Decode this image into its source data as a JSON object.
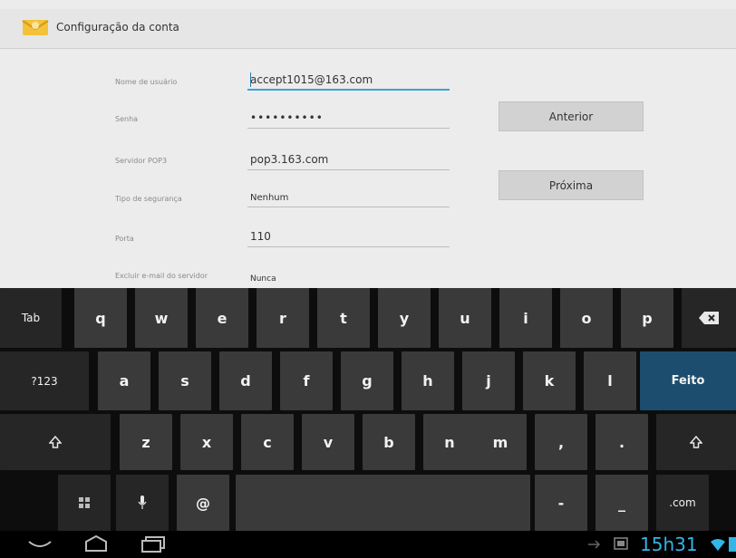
{
  "header": {
    "title": "Configuração da conta"
  },
  "form": {
    "fields": [
      {
        "label": "Nome de usuário",
        "value": "accept1015@163.com"
      },
      {
        "label": "Senha",
        "value": "••••••••••"
      },
      {
        "label": "Servidor POP3",
        "value": "pop3.163.com"
      },
      {
        "label": "Tipo de segurança",
        "value": "Nenhum"
      },
      {
        "label": "Porta",
        "value": "110"
      },
      {
        "label": "Excluir e-mail do servidor",
        "value": "Nunca"
      }
    ]
  },
  "buttons": {
    "previous": "Anterior",
    "next": "Próxima"
  },
  "keyboard": {
    "row1": [
      "Tab",
      "q",
      "w",
      "e",
      "r",
      "t",
      "y",
      "u",
      "i",
      "o",
      "p"
    ],
    "row2": [
      "?123",
      "a",
      "s",
      "d",
      "f",
      "g",
      "h",
      "j",
      "k",
      "l",
      "Feito"
    ],
    "row3": [
      "z",
      "x",
      "c",
      "v",
      "b",
      "n",
      "m",
      ",",
      "."
    ],
    "row4": {
      "at": "@",
      "dash": "-",
      "underscore": "_",
      "com": ".com"
    }
  },
  "status": {
    "time": "15h31"
  },
  "colors": {
    "accent": "#33b5e5",
    "done_key": "#1d4d6e",
    "focus_underline": "#3aa4d6"
  },
  "icons": [
    "email-settings-icon",
    "backspace-icon",
    "shift-icon",
    "emoji-icon",
    "microphone-icon",
    "back-icon",
    "home-icon",
    "recent-apps-icon",
    "usb-icon",
    "screenshot-icon",
    "wifi-icon"
  ]
}
